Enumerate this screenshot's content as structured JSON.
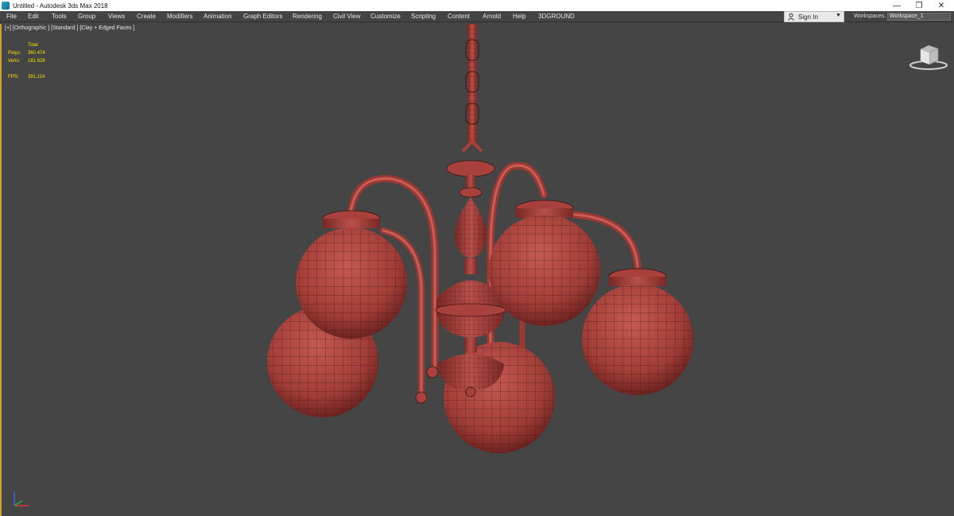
{
  "window": {
    "title": "Untitled - Autodesk 3ds Max 2018",
    "controls": {
      "minimize": "—",
      "maximize": "❐",
      "close": "✕"
    }
  },
  "menu": [
    "File",
    "Edit",
    "Tools",
    "Group",
    "Views",
    "Create",
    "Modifiers",
    "Animation",
    "Graph Editors",
    "Rendering",
    "Civil View",
    "Customize",
    "Scripting",
    "Content",
    "Arnold",
    "Help",
    "3DGROUND"
  ],
  "signin": {
    "label": "Sign In",
    "icon": "user-icon",
    "caret": "▼"
  },
  "workspaces": {
    "label": "Workspaces:",
    "value": "Workspace_1"
  },
  "viewport": {
    "label": "[+] [Orthographic ] [Standard ] [Clay + Edged Faces ]",
    "stats": {
      "total_label": "Total",
      "polys_label": "Polys:",
      "polys": "360 474",
      "verts_label": "Verts:",
      "verts": "181 628",
      "fps_label": "FPS:",
      "fps": "391,114"
    }
  },
  "scene": {
    "object": "chandelier",
    "material_color": "#a8403b",
    "wire_color": "#3a1412",
    "background": "#454545",
    "accent_border": "#c9a227"
  }
}
